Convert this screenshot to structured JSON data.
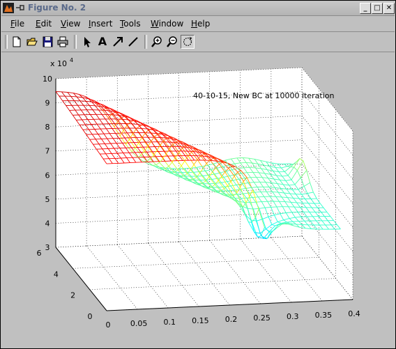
{
  "window": {
    "title": "Figure No. 2",
    "controls": [
      "_",
      "□",
      "✕"
    ],
    "app_icon": "matlab-figure-icon"
  },
  "menus": [
    {
      "label": "File",
      "u": "F",
      "rest": "ile"
    },
    {
      "label": "Edit",
      "u": "E",
      "rest": "dit"
    },
    {
      "label": "View",
      "u": "V",
      "rest": "iew"
    },
    {
      "label": "Insert",
      "u": "I",
      "rest": "nsert"
    },
    {
      "label": "Tools",
      "u": "T",
      "rest": "ools"
    },
    {
      "label": "Window",
      "u": "W",
      "rest": "indow"
    },
    {
      "label": "Help",
      "u": "H",
      "rest": "elp"
    }
  ],
  "toolbar": {
    "tools": [
      {
        "name": "new-figure",
        "icon": "new-document-icon"
      },
      {
        "name": "open-file",
        "icon": "open-folder-icon"
      },
      {
        "name": "save-figure",
        "icon": "save-icon"
      },
      {
        "name": "print-figure",
        "icon": "printer-icon"
      },
      {
        "name": "edit-plot",
        "icon": "arrow-cursor-icon"
      },
      {
        "name": "insert-text",
        "icon": "text-A-icon",
        "glyph": "A"
      },
      {
        "name": "insert-arrow",
        "icon": "arrow-icon"
      },
      {
        "name": "insert-line",
        "icon": "line-icon"
      },
      {
        "name": "zoom-in",
        "icon": "zoom-in-icon"
      },
      {
        "name": "zoom-out",
        "icon": "zoom-out-icon"
      },
      {
        "name": "rotate-3d",
        "icon": "rotate-icon",
        "active": true
      }
    ]
  },
  "chart_data": {
    "type": "surface",
    "style": "mesh",
    "colormap": "jet",
    "annotation": "40-10-15, New BC at 10000 iteration",
    "x_ticks": [
      "0",
      "0.05",
      "0.1",
      "0.15",
      "0.2",
      "0.25",
      "0.3",
      "0.35",
      "0.4"
    ],
    "y_ticks": [
      "0",
      "2",
      "4",
      "6"
    ],
    "z_ticks": [
      "3",
      "4",
      "5",
      "6",
      "7",
      "8",
      "9",
      "10"
    ],
    "z_exponent_label": "x 10",
    "z_exponent_power": "4",
    "xlim": [
      0,
      0.4
    ],
    "ylim": [
      0,
      6
    ],
    "zlim": [
      30000,
      100000
    ],
    "grid": true,
    "background": "#ffffff",
    "surface_description_values": {
      "x_range": [
        0,
        0.38
      ],
      "y_range": [
        0,
        6
      ],
      "plateau_high": 95000,
      "plateau_mid": 60000,
      "trough_min": 30000
    }
  }
}
